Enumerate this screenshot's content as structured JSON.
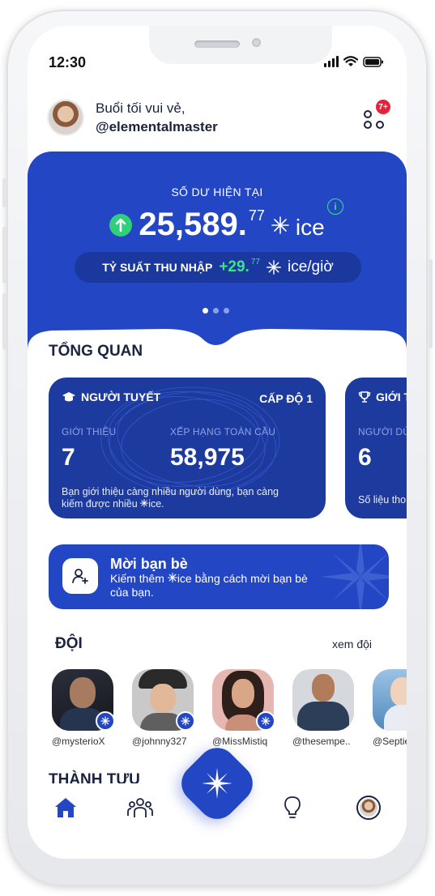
{
  "status": {
    "time": "12:30"
  },
  "header": {
    "greeting": "Buổi tối vui vẻ,",
    "username": "@elementalmaster",
    "notification_count": "7+"
  },
  "balance": {
    "label": "SỐ DƯ HIỆN TẠI",
    "amount": "25,589.",
    "decimals": "77",
    "unit": "ice",
    "rate_label": "TỶ SUẤT THU NHẬP",
    "rate_value": "+29.",
    "rate_decimals": "77",
    "rate_unit": "ice/giờ",
    "info_glyph": "i"
  },
  "overview": {
    "title": "TỔNG QUAN",
    "card1": {
      "title": "NGƯỜI TUYẾT",
      "level": "CẤP ĐỘ 1",
      "ref_label": "GIỚI THIỆU",
      "ref_value": "7",
      "rank_label": "XẾP HẠNG TOÀN CẦU",
      "rank_value": "58,975",
      "footer_a": "Bạn giới thiệu càng nhiều người dùng, bạn càng",
      "footer_b": "kiếm được nhiều",
      "footer_c": "ice."
    },
    "card2": {
      "title": "GIỚI T",
      "label": "NGƯỜI DÙ",
      "value": "6",
      "footer": "Số liệu tho"
    }
  },
  "invite": {
    "title": "Mời bạn bè",
    "line_a": "Kiếm thêm",
    "line_b": "ice bằng cách mời bạn bè",
    "line_c": "của bạn."
  },
  "team": {
    "title": "ĐỘI",
    "link": "xem đội",
    "members": [
      {
        "name": "@mysterioX"
      },
      {
        "name": "@johnny327"
      },
      {
        "name": "@MissMistiq"
      },
      {
        "name": "@thesempe.."
      },
      {
        "name": "@Septie"
      }
    ]
  },
  "achievements": {
    "title": "THÀNH TỰU"
  },
  "icons": [
    "home-icon",
    "team-icon",
    "ice-star-icon",
    "bulb-icon",
    "profile-icon",
    "trophy-icon",
    "graduation-cap-icon",
    "add-user-icon"
  ],
  "colors": {
    "primary": "#2346c4",
    "dark": "#1d3a9e",
    "accent_green": "#3ee28a",
    "badge_red": "#e8213a",
    "text": "#1b2340"
  }
}
